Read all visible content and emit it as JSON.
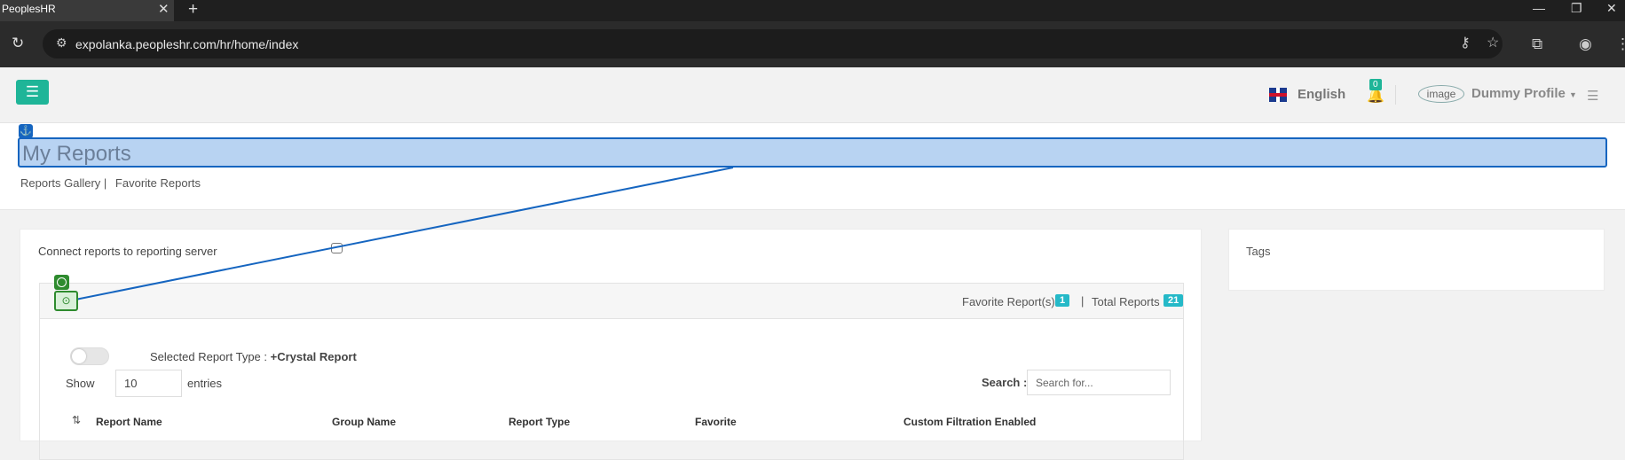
{
  "browser": {
    "tab_title": "PeoplesHR",
    "url": "expolanka.peopleshr.com/hr/home/index"
  },
  "header": {
    "language": "English",
    "notification_count": "0",
    "avatar_alt": "image",
    "profile_name": "Dummy Profile"
  },
  "page": {
    "title": "My Reports",
    "breadcrumbs": [
      "Reports Gallery |",
      "Favorite Reports"
    ]
  },
  "reports_panel": {
    "connect_label": "Connect reports to reporting server",
    "favorite_label": "Favorite Report(s)",
    "favorite_count": "1",
    "separator": "|",
    "total_label": "Total Reports",
    "total_count": "21",
    "selected_type_label": "Selected Report Type : ",
    "selected_type_value": "+Crystal Report",
    "show_label": "Show",
    "entries_value": "10",
    "entries_label": "entries",
    "search_label": "Search :",
    "search_placeholder": "Search for...",
    "columns": [
      "Report Name",
      "Group Name",
      "Report Type",
      "Favorite",
      "Custom Filtration Enabled"
    ]
  },
  "tags_panel": {
    "label": "Tags"
  },
  "colors": {
    "accent": "#1fb598",
    "badge": "#25b9c8",
    "selection": "#1565c0"
  }
}
